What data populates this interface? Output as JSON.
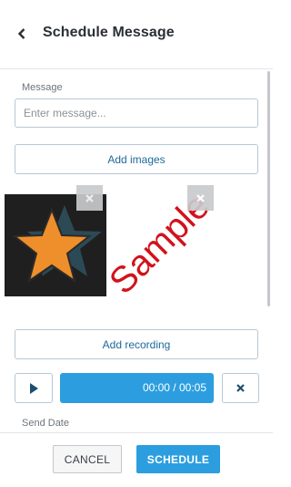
{
  "header": {
    "title": "Schedule Message",
    "back_icon": "chevron-left-icon"
  },
  "form": {
    "message_label": "Message",
    "message_placeholder": "Enter message...",
    "message_value": "",
    "add_images_label": "Add images",
    "images": [
      {
        "name": "star",
        "remove_icon": "close-icon"
      },
      {
        "name": "sample",
        "text": "Sample",
        "remove_icon": "close-icon"
      }
    ],
    "add_recording_label": "Add recording",
    "audio": {
      "play_icon": "play-icon",
      "time": "00:00 / 00:05",
      "delete_icon": "close-icon"
    },
    "send_date_label": "Send Date"
  },
  "footer": {
    "cancel_label": "CANCEL",
    "schedule_label": "SCHEDULE"
  },
  "colors": {
    "accent": "#2c9ee0",
    "link": "#1d6a9a",
    "border": "#b7c7d6",
    "sample_red": "#d2121c"
  }
}
